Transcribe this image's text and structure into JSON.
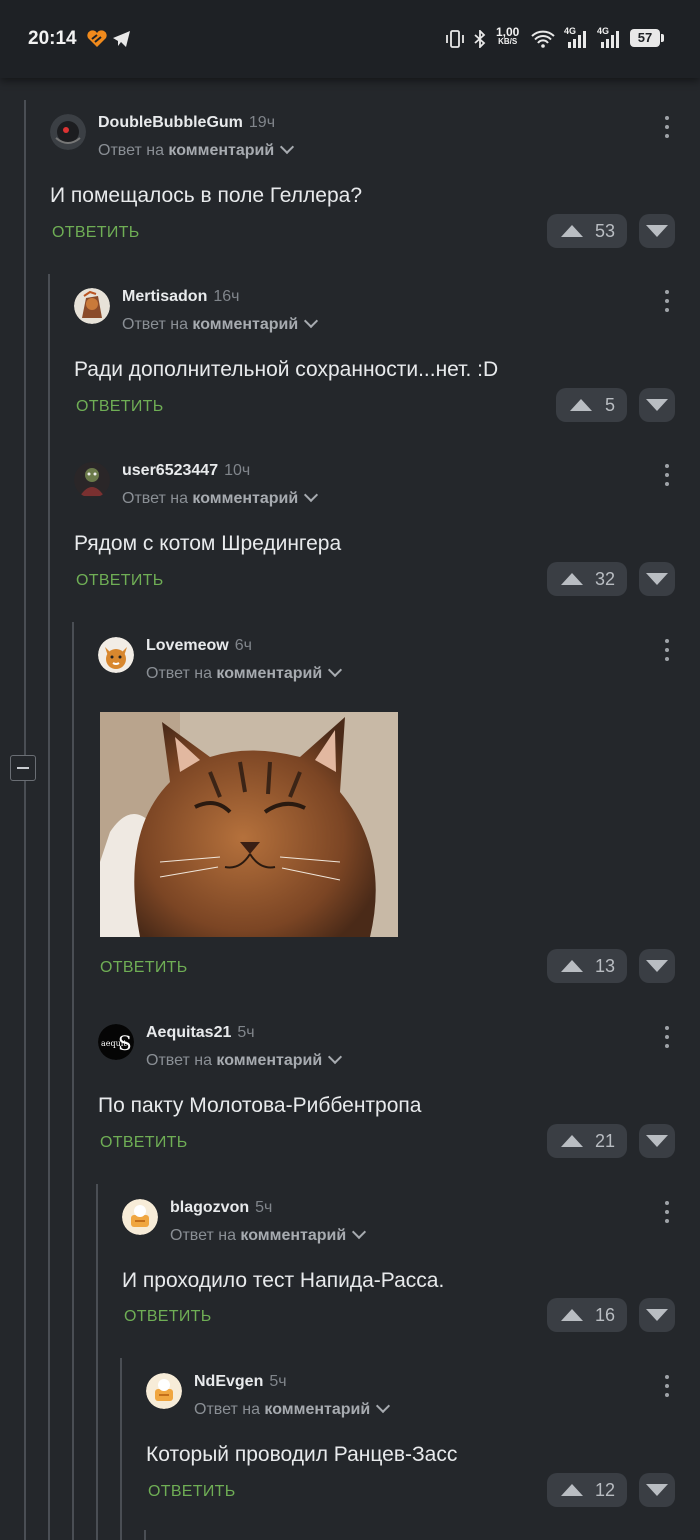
{
  "status_bar": {
    "time": "20:14",
    "speed_value": "1,00",
    "speed_unit": "KB/S",
    "battery": "57",
    "network_1": "4G",
    "network_2": "4G",
    "icons": [
      "orange-app-icon",
      "telegram-icon",
      "vibrate-icon",
      "bluetooth-icon",
      "wifi-icon",
      "signal-icon",
      "signal-icon",
      "battery-icon"
    ]
  },
  "common": {
    "reply_prefix": "Ответ на",
    "reply_target": "комментарий",
    "reply_button": "ОТВЕТИТЬ"
  },
  "comments": [
    {
      "author": "DoubleBubbleGum",
      "time": "19ч",
      "text": "И помещалось в поле Геллера?",
      "votes": "53"
    },
    {
      "author": "Mertisadon",
      "time": "16ч",
      "text": "Ради дополнительной сохранности...нет. :D",
      "votes": "5"
    },
    {
      "author": "user6523447",
      "time": "10ч",
      "text": "Рядом с котом Шредингера",
      "votes": "32"
    },
    {
      "author": "Lovemeow",
      "time": "6ч",
      "text": "",
      "votes": "13"
    },
    {
      "author": "Aequitas21",
      "time": "5ч",
      "text": "По пакту Молотова-Риббентропа",
      "votes": "21"
    },
    {
      "author": "blagozvon",
      "time": "5ч",
      "text": "И проходило тест Напида-Расса.",
      "votes": "16"
    },
    {
      "author": "NdEvgen",
      "time": "5ч",
      "text": "Который проводил Ранцев-Засс",
      "votes": "12"
    }
  ],
  "colors": {
    "background": "#24272b",
    "reply_link": "#6fae55",
    "vote_bg": "#3a3e44"
  }
}
